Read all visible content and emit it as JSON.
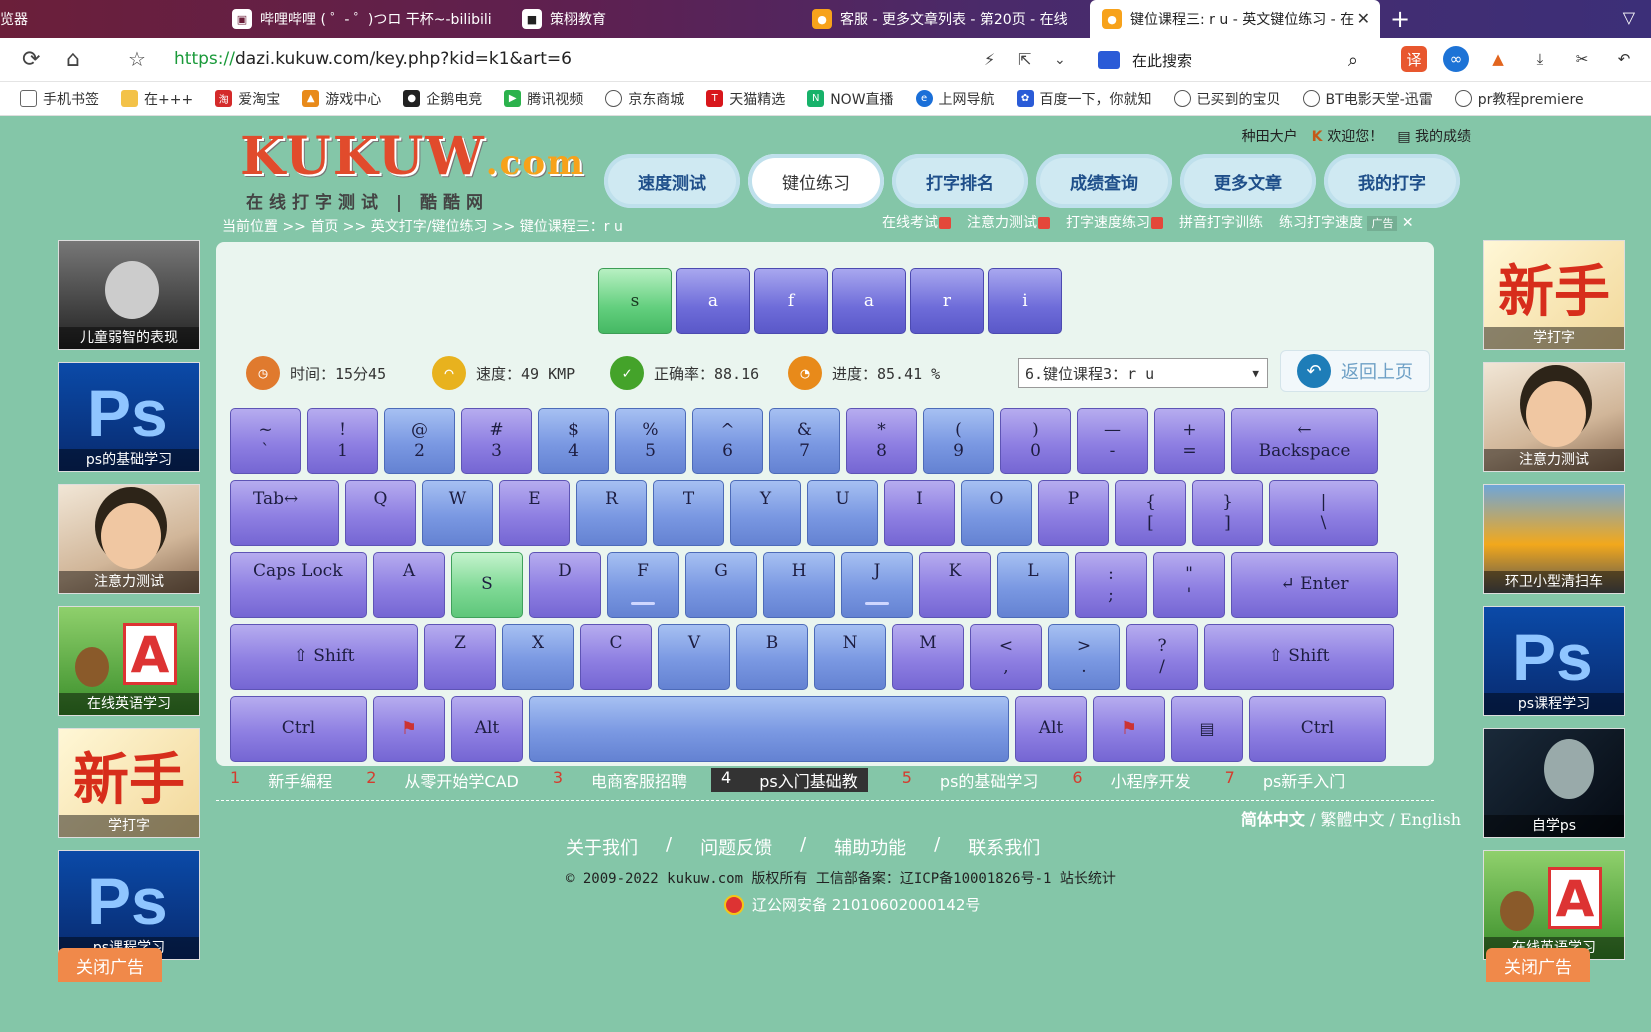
{
  "browser": {
    "tabs": [
      {
        "label": "览器",
        "icon": ""
      },
      {
        "label": "哔哩哔哩 ( ゜- ゜)つロ 干杯~-bilibili",
        "icon": "tv-icon"
      },
      {
        "label": "策栩教育",
        "icon": "school-icon"
      },
      {
        "label": "客服 - 更多文章列表 - 第20页 - 在线",
        "icon": "kukuw-icon"
      },
      {
        "label": "键位课程三: r u - 英文键位练习 - 在",
        "icon": "kukuw-icon"
      }
    ],
    "url_scheme": "https://",
    "url_rest": "dazi.kukuw.com/key.php?kid=k1&art=6",
    "search_placeholder": "在此搜索",
    "bookmarks": [
      "手机书签",
      "在+++",
      "爱淘宝",
      "游戏中心",
      "企鹅电竞",
      "腾讯视频",
      "京东商城",
      "天猫精选",
      "NOW直播",
      "上网导航",
      "百度一下，你就知",
      "已买到的宝贝",
      "BT电影天堂-迅雷",
      "pr教程premiere"
    ]
  },
  "header": {
    "logo_main": "KUKUW",
    "logo_dot": ".com",
    "logo_sub": "在线打字测试 | 酷酷网",
    "user": "种田大户",
    "welcome": "欢迎您！",
    "my_scores": "我的成绩",
    "nav": [
      "速度测试",
      "键位练习",
      "打字排名",
      "成绩查询",
      "更多文章",
      "我的打字"
    ],
    "breadcrumb": "当前位置 >> 首页 >> 英文打字/键位练习 >> 键位课程三：r u",
    "sublinks": [
      "在线考试",
      "注意力测试",
      "打字速度练习",
      "拼音打字训练",
      "练习打字速度"
    ],
    "ad_label": "广告"
  },
  "practice": {
    "word": [
      "s",
      "a",
      "f",
      "a",
      "r",
      "i"
    ],
    "time_label": "时间：15分45",
    "speed_label": "速度：49 KMP",
    "accuracy_label": "正确率：88.16",
    "progress_label": "进度：85.41 %",
    "progress_value": 85.41,
    "lesson_select": "6.键位课程3：r u",
    "back_label": "返回上页"
  },
  "keyboard": {
    "row1": [
      [
        "~",
        "`"
      ],
      [
        "!",
        "1"
      ],
      [
        "@",
        "2"
      ],
      [
        "#",
        "3"
      ],
      [
        "$",
        "4"
      ],
      [
        "%",
        "5"
      ],
      [
        "^",
        "6"
      ],
      [
        "&",
        "7"
      ],
      [
        "*",
        "8"
      ],
      [
        "(",
        "9"
      ],
      [
        ")",
        "0"
      ],
      [
        "—",
        "-"
      ],
      [
        "+",
        "="
      ]
    ],
    "backspace": [
      "←",
      "Backspace"
    ],
    "tab": "Tab↔",
    "row2": [
      "Q",
      "W",
      "E",
      "R",
      "T",
      "Y",
      "U",
      "I",
      "O",
      "P"
    ],
    "row2b": [
      [
        "{",
        "["
      ],
      [
        "}",
        "]"
      ],
      [
        "|",
        "\\"
      ]
    ],
    "caps": "Caps Lock",
    "row3": [
      "A",
      "S",
      "D",
      "F",
      "G",
      "H",
      "J",
      "K",
      "L"
    ],
    "row3b": [
      [
        ":",
        ";"
      ],
      [
        "\"",
        "'"
      ]
    ],
    "enter": "↵ Enter",
    "shift": "⇧ Shift",
    "row4": [
      "Z",
      "X",
      "C",
      "V",
      "B",
      "N",
      "M"
    ],
    "row4b": [
      [
        "<",
        ","
      ],
      [
        ">",
        "."
      ],
      [
        "?",
        "/"
      ]
    ],
    "ctrl": "Ctrl",
    "alt": "Alt"
  },
  "bottom_tags": [
    [
      "1",
      "新手编程"
    ],
    [
      "2",
      "从零开始学CAD"
    ],
    [
      "3",
      "电商客服招聘"
    ],
    [
      "4",
      "ps入门基础教"
    ],
    [
      "5",
      "ps的基础学习"
    ],
    [
      "6",
      "小程序开发"
    ],
    [
      "7",
      "ps新手入门"
    ]
  ],
  "footer": {
    "lang_active": "简体中文",
    "lang_rest": " / 繁體中文 / English",
    "links": [
      "关于我们",
      "/",
      "问题反馈",
      "/",
      "辅助功能",
      "/",
      "联系我们"
    ],
    "copyright": "© 2009-2022 kukuw.com 版权所有 工信部备案：辽ICP备10001826号-1 站长统计",
    "icp": "辽公网安备 21010602000142号"
  },
  "left_ads": [
    "儿童弱智的表现",
    "ps的基础学习",
    "注意力测试",
    "在线英语学习",
    "学打字",
    "ps课程学习"
  ],
  "right_ads": [
    "学打字",
    "注意力测试",
    "环卫小型清扫车",
    "ps课程学习",
    "自学ps",
    "在线英语学习"
  ],
  "close_ad": "关闭广告",
  "colors": {
    "bg": "#84c6a8",
    "key": "#8e7fe2",
    "key_highlight": "#63cf7e"
  }
}
